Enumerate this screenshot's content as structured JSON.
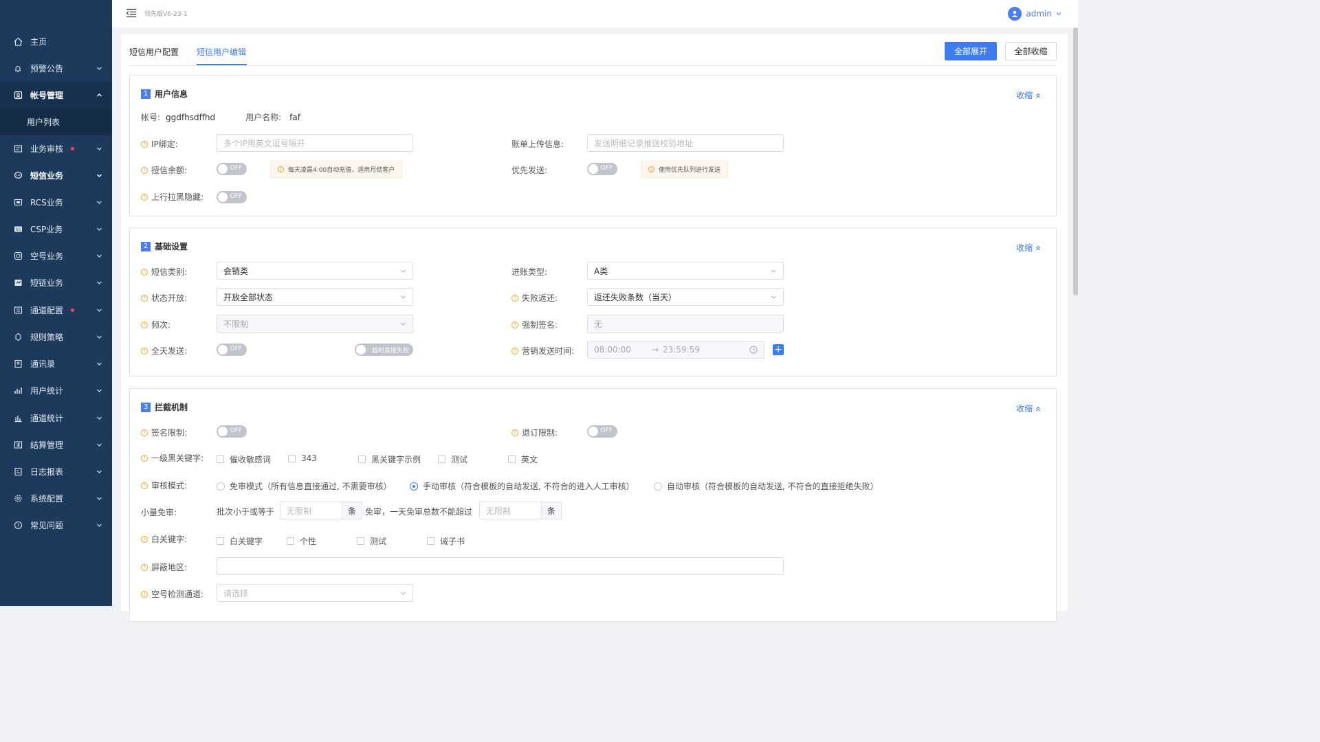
{
  "sidebar": {
    "items": [
      {
        "label": "主页",
        "icon": "home-icon"
      },
      {
        "label": "预警公告",
        "icon": "bell-icon"
      },
      {
        "label": "帐号管理",
        "icon": "account-icon"
      },
      {
        "label": "用户列表"
      },
      {
        "label": "业务审核",
        "icon": "audit-icon"
      },
      {
        "label": "短信业务",
        "icon": "message-icon"
      },
      {
        "label": "RCS业务",
        "icon": "rcs-icon"
      },
      {
        "label": "CSP业务",
        "icon": "csp-icon"
      },
      {
        "label": "空号业务",
        "icon": "empty-number-icon"
      },
      {
        "label": "短链业务",
        "icon": "short-link-icon"
      },
      {
        "label": "通道配置",
        "icon": "channel-config-icon"
      },
      {
        "label": "规则策略",
        "icon": "rule-icon"
      },
      {
        "label": "通讯录",
        "icon": "contacts-icon"
      },
      {
        "label": "用户统计",
        "icon": "user-stats-icon"
      },
      {
        "label": "通道统计",
        "icon": "channel-stats-icon"
      },
      {
        "label": "结算管理",
        "icon": "settlement-icon"
      },
      {
        "label": "日志报表",
        "icon": "log-report-icon"
      },
      {
        "label": "系统配置",
        "icon": "gear-icon"
      },
      {
        "label": "常见问题",
        "icon": "question-icon"
      }
    ]
  },
  "topbar": {
    "version": "领先版V6-23-1",
    "user": "admin"
  },
  "tabs": [
    "短信用户配置",
    "短信用户编辑"
  ],
  "actions": {
    "expand_all": "全部展开",
    "collapse_all": "全部收缩"
  },
  "collapse_label": "收缩",
  "sections": {
    "user_info": {
      "num": "1",
      "title": "用户信息",
      "account_label": "帐号:",
      "account_value": "ggdfhsdffhd",
      "username_label": "用户名称:",
      "username_value": "faf",
      "ip_label": "IP绑定:",
      "ip_placeholder": "多个IP用英文逗号隔开",
      "bill_label": "账单上传信息:",
      "bill_placeholder": "发送明细记录推送校验地址",
      "credit_label": "授信余额:",
      "credit_hint": "每天凌晨4:00自动充值，适用月结客户",
      "priority_label": "优先发送:",
      "priority_hint": "使用优先队列进行发送",
      "upstream_label": "上行拉黑隐藏:",
      "off": "OFF"
    },
    "basic": {
      "num": "2",
      "title": "基础设置",
      "sms_type_label": "短信类别:",
      "sms_type_value": "会销类",
      "account_type_label": "进账类型:",
      "account_type_value": "A类",
      "status_label": "状态开放:",
      "status_value": "开放全部状态",
      "fail_return_label": "失败返还:",
      "fail_return_value": "返还失败条数（当天）",
      "freq_label": "频次:",
      "freq_value": "不限制",
      "force_sign_label": "强制签名:",
      "force_sign_value": "无",
      "allday_label": "全天发送:",
      "timeout_fail": "超时直接失败",
      "marketing_time_label": "营销发送时间:",
      "time_start": "08:00:00",
      "time_end": "23:59:59"
    },
    "intercept": {
      "num": "3",
      "title": "拦截机制",
      "sign_limit_label": "签名限制:",
      "unsub_limit_label": "退订限制:",
      "black_kw_label": "一级黑关键字:",
      "black_kw_options": [
        "催收敏感词",
        "343",
        "黑关键字示例",
        "测试",
        "英文"
      ],
      "audit_mode_label": "审核模式:",
      "audit_options": [
        "免审模式（所有信息直接通过, 不需要审核）",
        "手动审核（符合模板的自动发送, 不符合的进入人工审核）",
        "自动审核（符合模板的自动发送, 不符合的直接拒绝失败）"
      ],
      "audit_selected": 1,
      "small_label": "小量免审:",
      "small_pre": "批次小于或等于",
      "small_placeholder": "无限制",
      "unit": "条",
      "small_mid": "免审，一天免审总数不能超过",
      "white_kw_label": "白关键字:",
      "white_kw_options": [
        "白关键字",
        "个性",
        "测试",
        "诫子书"
      ],
      "block_region_label": "屏蔽地区:",
      "empty_check_label": "空号检测通道:",
      "empty_check_placeholder": "请选择"
    }
  },
  "colors": {
    "primary": "#3c7cf0",
    "sidebar": "#1d3a5c",
    "warning": "#f5a623"
  }
}
